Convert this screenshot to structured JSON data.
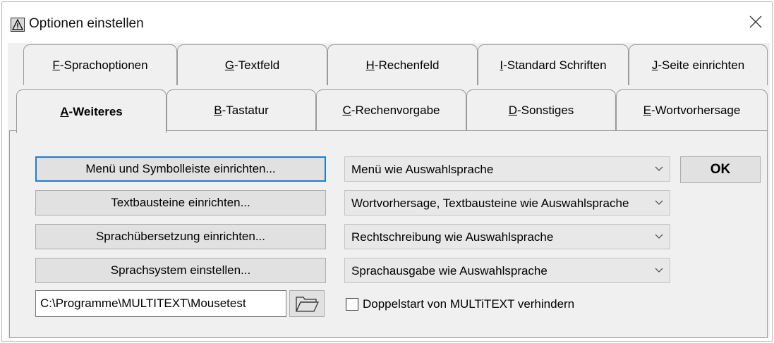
{
  "window": {
    "title": "Optionen einstellen"
  },
  "tabs_row_back": [
    {
      "key": "F",
      "rest": "-Sprachoptionen"
    },
    {
      "key": "G",
      "rest": "-Textfeld"
    },
    {
      "key": "H",
      "rest": "-Rechenfeld"
    },
    {
      "key": "I",
      "rest": "-Standard Schriften"
    },
    {
      "key": "J",
      "rest": "-Seite einrichten"
    }
  ],
  "tabs_row_front": [
    {
      "key": "A",
      "rest": "-Weiteres",
      "selected": true
    },
    {
      "key": "B",
      "rest": "-Tastatur"
    },
    {
      "key": "C",
      "rest": "-Rechenvorgabe"
    },
    {
      "key": "D",
      "rest": "-Sonstiges"
    },
    {
      "key": "E",
      "rest": "-Wortvorhersage"
    }
  ],
  "buttons": {
    "menu_setup": "Menü und Symbolleiste einrichten...",
    "textblocks_setup": "Textbausteine einrichten...",
    "translation_setup": "Sprachübersetzung einrichten...",
    "speech_system_setup": "Sprachsystem einstellen...",
    "ok": "OK"
  },
  "dropdowns": {
    "menu_language": "Menü wie Auswahlsprache",
    "prediction_language": "Wortvorhersage, Textbausteine wie Auswahlsprache",
    "spelling_language": "Rechtschreibung wie Auswahlsprache",
    "speech_output_language": "Sprachausgabe wie Auswahlsprache"
  },
  "path_field": {
    "value": "C:\\Programme\\MULTITEXT\\Mousetest"
  },
  "checkbox": {
    "label": "Doppelstart von MULTiTEXT verhindern",
    "checked": false
  },
  "icons": {
    "app": "warning-triangle-icon",
    "close": "close-icon",
    "dropdown": "chevron-down-icon",
    "folder": "folder-icon"
  },
  "colors": {
    "focus_border": "#1a7fd6",
    "dialog_bg": "#f0f0f0",
    "button_bg": "#e1e1e1"
  }
}
